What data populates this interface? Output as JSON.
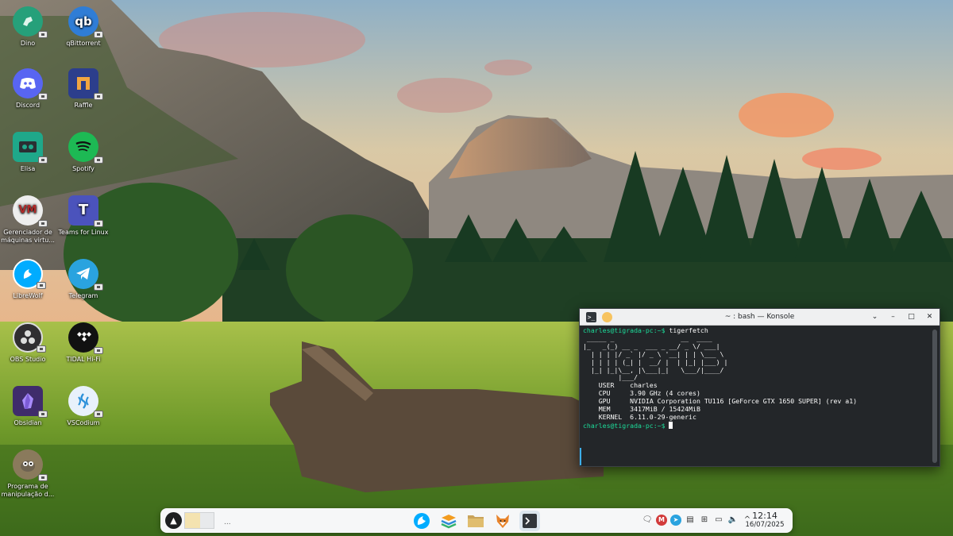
{
  "desktop": {
    "icons": [
      {
        "label": "Dino",
        "icon": "dino-icon",
        "color": "#26a07a"
      },
      {
        "label": "qBittorrent",
        "icon": "qbittorrent-icon",
        "color": "#2f7dd6"
      },
      {
        "label": "Discord",
        "icon": "discord-icon",
        "color": "#5865f2"
      },
      {
        "label": "Raffle",
        "icon": "raffle-icon",
        "color": "#2c3e8c"
      },
      {
        "label": "Elisa",
        "icon": "elisa-icon",
        "color": "#1fa88a"
      },
      {
        "label": "Spotify",
        "icon": "spotify-icon",
        "color": "#1db954"
      },
      {
        "label": "Gerenciador de máquinas virtu...",
        "icon": "virt-manager-icon",
        "color": "#eeeeee"
      },
      {
        "label": "Teams for Linux",
        "icon": "teams-icon",
        "color": "#4b53bc"
      },
      {
        "label": "LibreWolf",
        "icon": "librewolf-icon",
        "color": "#00acff"
      },
      {
        "label": "Telegram",
        "icon": "telegram-icon",
        "color": "#2aa3df"
      },
      {
        "label": "OBS Studio",
        "icon": "obs-icon",
        "color": "#302e31"
      },
      {
        "label": "TIDAL Hi-Fi",
        "icon": "tidal-icon",
        "color": "#111111"
      },
      {
        "label": "Obsidian",
        "icon": "obsidian-icon",
        "color": "#3f2c6b"
      },
      {
        "label": "VSCodium",
        "icon": "vscodium-icon",
        "color": "#e8f1fb"
      },
      {
        "label": "Programa de manipulação d...",
        "icon": "gimp-icon",
        "color": "#8a7a5c"
      }
    ]
  },
  "konsole": {
    "title": "~ : bash — Konsole",
    "app_glyph": ">_",
    "prompt": "charles@tigrada-pc:~$",
    "command": "tigerfetch",
    "ascii": [
      " _____ _                 __  ____  ",
      "|_   _(_) __ _  ___ _ __/ _ \\/ ___| ",
      "  | | | |/ _` |/ _ \\ '__| | | \\___ \\ ",
      "  | | | | (_| |  __/ |  | |_| |___) |",
      "  |_| |_|\\__, |\\___|_|   \\___/|____/ ",
      "         |___/                       "
    ],
    "info": [
      {
        "key": "USER",
        "value": "charles"
      },
      {
        "key": "CPU",
        "value": "3.90 GHz (4 cores)"
      },
      {
        "key": "GPU",
        "value": "NVIDIA Corporation TU116 [GeForce GTX 1650 SUPER] (rev a1)"
      },
      {
        "key": "MEM",
        "value": "3417MiB / 15424MiB"
      },
      {
        "key": "KERNEL",
        "value": "6.11.0-29-generic"
      }
    ],
    "last_prompt": "charles@tigrada-pc:~$"
  },
  "panel": {
    "separator": "...",
    "clock_time": "12:14",
    "clock_date": "16/07/2025",
    "tray_expand": "^",
    "tasks": [
      "librewolf-icon",
      "stack-icon",
      "files-icon",
      "fox-icon",
      "konsole-icon"
    ]
  }
}
